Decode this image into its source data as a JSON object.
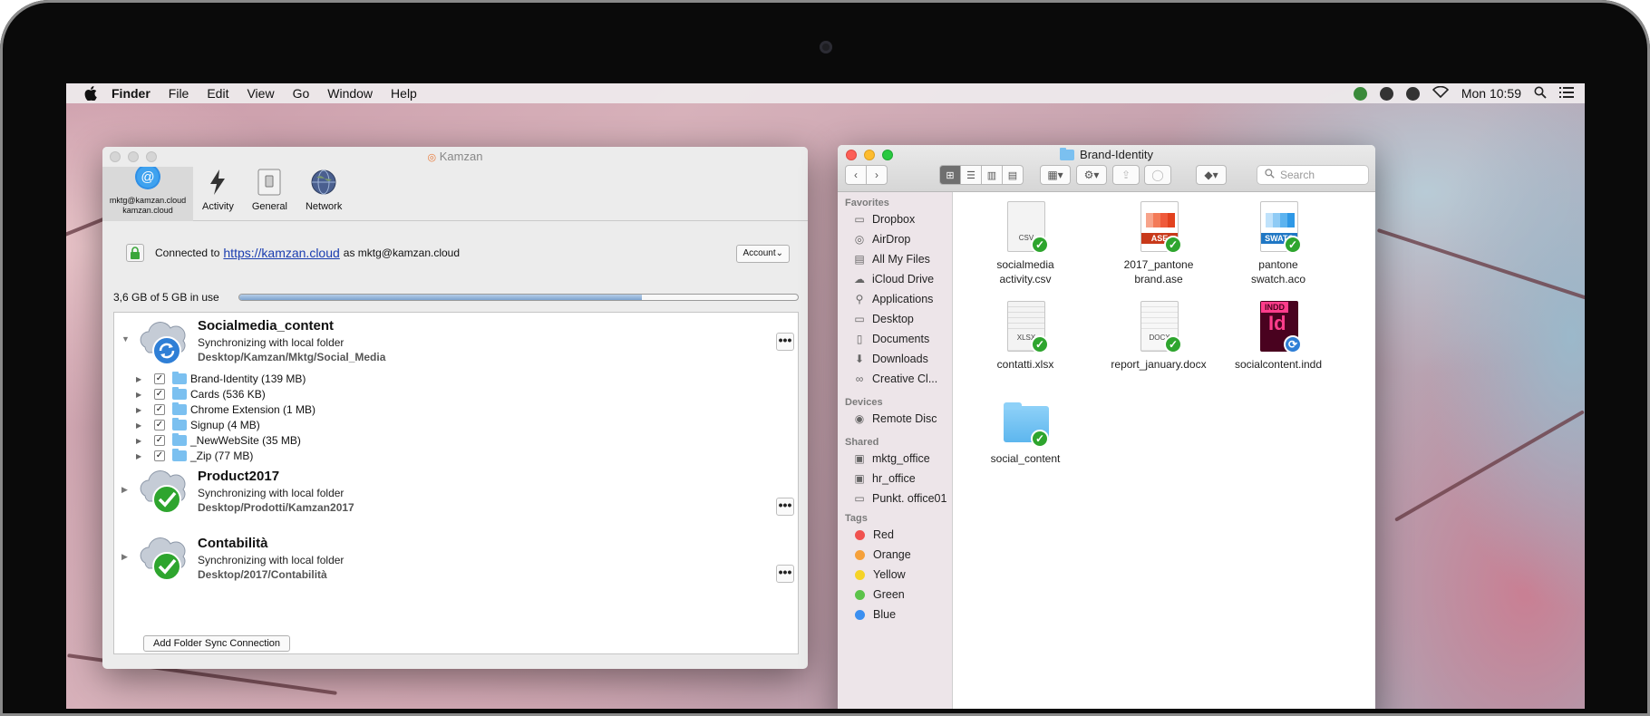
{
  "menubar": {
    "app": "Finder",
    "items": [
      "File",
      "Edit",
      "View",
      "Go",
      "Window",
      "Help"
    ],
    "clock": "Mon 10:59"
  },
  "kamzan": {
    "title": "Kamzan",
    "tabs": [
      {
        "label": "mktg@kamzan.cloud\nkamzan.cloud",
        "icon": "at-icon"
      },
      {
        "label": "Activity",
        "icon": "lightning-icon"
      },
      {
        "label": "General",
        "icon": "switch-icon"
      },
      {
        "label": "Network",
        "icon": "globe-icon"
      }
    ],
    "account_line1": "mktg@kamzan.cloud",
    "account_line2": "kamzan.cloud",
    "connected_prefix": "Connected to",
    "connected_link": "https://kamzan.cloud",
    "connected_suffix": "as mktg@kamzan.cloud",
    "account_button": "Account",
    "usage_text": "3,6 GB of 5 GB in use",
    "usage_fraction": 0.72,
    "syncs": [
      {
        "name": "Socialmedia_content",
        "status": "Synchronizing with local folder",
        "path": "Desktop/Kamzan/Mktg/Social_Media",
        "state": "syncing",
        "expanded": true
      },
      {
        "name": "Product2017",
        "status": "Synchronizing with local folder",
        "path": "Desktop/Prodotti/Kamzan2017",
        "state": "done",
        "expanded": false
      },
      {
        "name": "Contabilità",
        "status": "Synchronizing with local folder",
        "path": "Desktop/2017/Contabilità",
        "state": "done",
        "expanded": false
      }
    ],
    "subfolders": [
      "Brand-Identity (139 MB)",
      "Cards (536 KB)",
      "Chrome Extension (1 MB)",
      "Signup (4 MB)",
      "_NewWebSite (35 MB)",
      "_Zip (77 MB)"
    ],
    "add_button": "Add Folder Sync Connection"
  },
  "finder": {
    "title": "Brand-Identity",
    "search_placeholder": "Search",
    "sections": {
      "favorites": "Favorites",
      "devices": "Devices",
      "shared": "Shared",
      "tags": "Tags"
    },
    "favorites": [
      "Dropbox",
      "AirDrop",
      "All My Files",
      "iCloud Drive",
      "Applications",
      "Desktop",
      "Documents",
      "Downloads",
      "Creative Cl..."
    ],
    "devices": [
      "Remote Disc"
    ],
    "shared": [
      "mktg_office",
      "hr_office",
      "Punkt. office01"
    ],
    "tags": [
      {
        "name": "Red",
        "color": "#f0524f"
      },
      {
        "name": "Orange",
        "color": "#f5a03a"
      },
      {
        "name": "Yellow",
        "color": "#f5d327"
      },
      {
        "name": "Green",
        "color": "#5cc34a"
      },
      {
        "name": "Blue",
        "color": "#3b8ff0"
      }
    ],
    "files": [
      {
        "name": "socialmedia\nactivity.csv",
        "label": "CSV",
        "kind": "csv",
        "status": "synced"
      },
      {
        "name": "2017_pantone\nbrand.ase",
        "label": "ASE",
        "kind": "ase",
        "status": "synced"
      },
      {
        "name": "pantone\nswatch.aco",
        "label": "SWATC",
        "kind": "aco",
        "status": "synced"
      },
      {
        "name": "contatti.xlsx",
        "label": "XLSX",
        "kind": "xlsx",
        "status": "synced"
      },
      {
        "name": "report_january.docx",
        "label": "DOCX",
        "kind": "docx",
        "status": "synced"
      },
      {
        "name": "socialcontent.indd",
        "label": "INDD",
        "kind": "indd",
        "status": "syncing"
      },
      {
        "name": "social_content",
        "label": "",
        "kind": "folder",
        "status": "synced"
      }
    ]
  },
  "colors": {
    "sync_blue": "#2f7fd6",
    "sync_green": "#2ea52e",
    "link": "#1a3db0"
  }
}
